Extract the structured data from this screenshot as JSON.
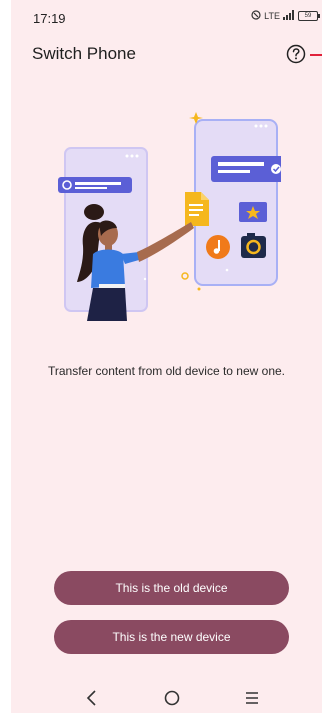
{
  "status": {
    "time": "17:19",
    "network": "LTE",
    "battery": "59"
  },
  "header": {
    "title": "Switch Phone",
    "help_icon": "help-circle-icon"
  },
  "main": {
    "caption": "Transfer content from old device to new one."
  },
  "actions": {
    "old_device_label": "This is the old device",
    "new_device_label": "This is the new device"
  },
  "nav": {
    "back": "back-icon",
    "home": "home-icon",
    "menu": "menu-icon"
  },
  "colors": {
    "background": "#fdecee",
    "button": "#8a4a61",
    "accent": "#5b5fd6"
  }
}
